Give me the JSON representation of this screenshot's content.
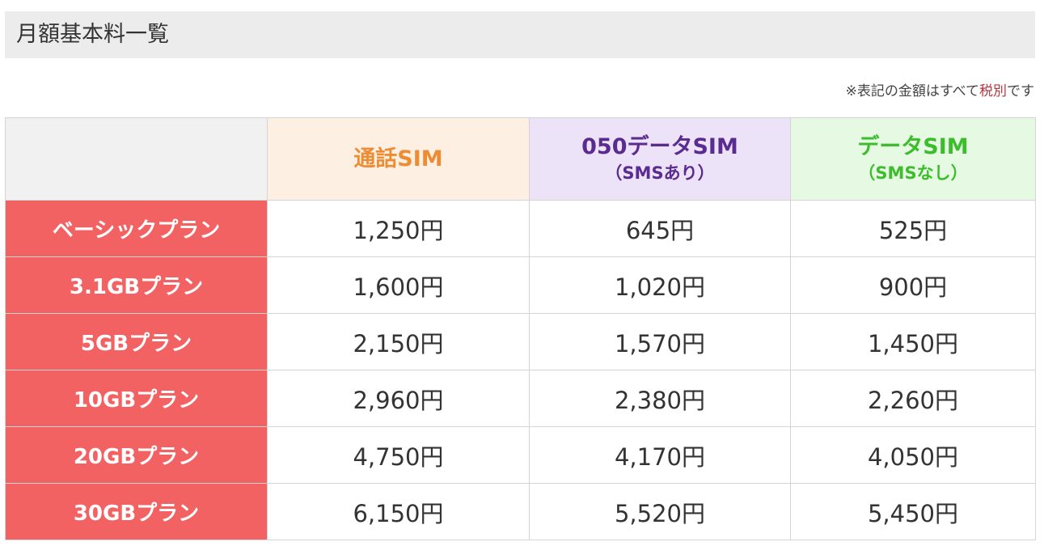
{
  "page_title": "月額基本料一覧",
  "note": {
    "prefix": "※表記の金額はすべて",
    "highlight": "税別",
    "suffix": "です"
  },
  "colors": {
    "plan_header_bg": "#f36262",
    "voice_sim": "#ee8c33",
    "sim_050": "#5b2c8f",
    "data_sim": "#3dbd2d"
  },
  "table": {
    "columns": [
      {
        "name": "通話SIM",
        "sub": ""
      },
      {
        "name": "050データSIM",
        "sub": "（SMSあり）"
      },
      {
        "name": "データSIM",
        "sub": "（SMSなし）"
      }
    ],
    "rows": [
      {
        "plan": "ベーシックプラン",
        "prices": [
          "1,250円",
          "645円",
          "525円"
        ]
      },
      {
        "plan": "3.1GBプラン",
        "prices": [
          "1,600円",
          "1,020円",
          "900円"
        ]
      },
      {
        "plan": "5GBプラン",
        "prices": [
          "2,150円",
          "1,570円",
          "1,450円"
        ]
      },
      {
        "plan": "10GBプラン",
        "prices": [
          "2,960円",
          "2,380円",
          "2,260円"
        ]
      },
      {
        "plan": "20GBプラン",
        "prices": [
          "4,750円",
          "4,170円",
          "4,050円"
        ]
      },
      {
        "plan": "30GBプラン",
        "prices": [
          "6,150円",
          "5,520円",
          "5,450円"
        ]
      }
    ]
  }
}
